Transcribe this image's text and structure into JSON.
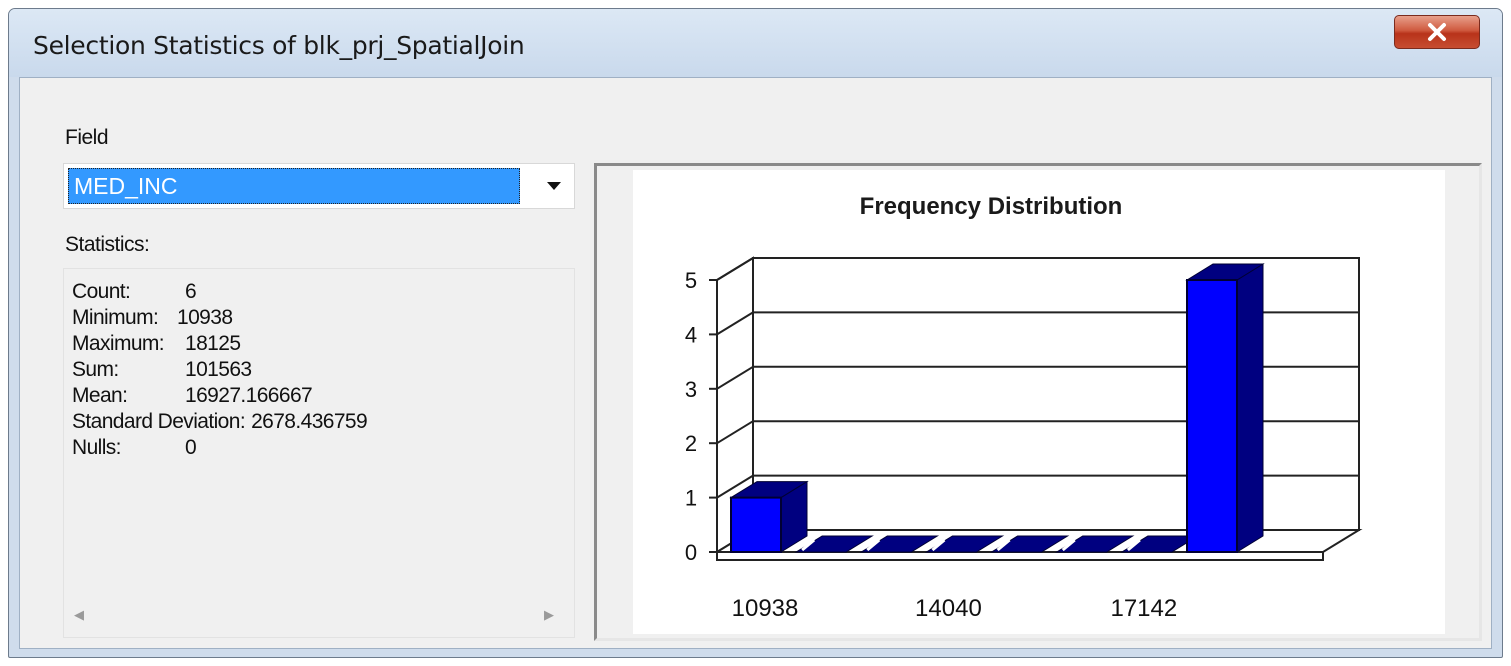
{
  "window": {
    "title": "Selection Statistics of blk_prj_SpatialJoin",
    "close_label": "x"
  },
  "field": {
    "label": "Field",
    "selected": "MED_INC"
  },
  "statistics": {
    "label": "Statistics:",
    "rows": [
      {
        "key": "Count:",
        "value": "6"
      },
      {
        "key": "Minimum:",
        "value": "10938"
      },
      {
        "key": "Maximum:",
        "value": "18125"
      },
      {
        "key": "Sum:",
        "value": "101563"
      },
      {
        "key": "Mean:",
        "value": "16927.166667"
      },
      {
        "key": "Standard Deviation:",
        "value": "2678.436759"
      },
      {
        "key": "Nulls:",
        "value": "0"
      }
    ]
  },
  "chart_data": {
    "type": "bar",
    "title": "Frequency Distribution",
    "xlabel": "",
    "ylabel": "",
    "x_tick_labels": [
      "10938",
      "14040",
      "17142"
    ],
    "bins": 8,
    "values": [
      1,
      0,
      0,
      0,
      0,
      0,
      0,
      5
    ],
    "ylim": [
      0,
      5
    ],
    "y_ticks": [
      0,
      1,
      2,
      3,
      4,
      5
    ],
    "grid": true,
    "bar_color": "#0000ff",
    "bar_side_color": "#000080",
    "style": "3d"
  },
  "colors": {
    "selection": "#3399ff",
    "titlebar": "#cfdcec",
    "close": "#c64d31"
  }
}
